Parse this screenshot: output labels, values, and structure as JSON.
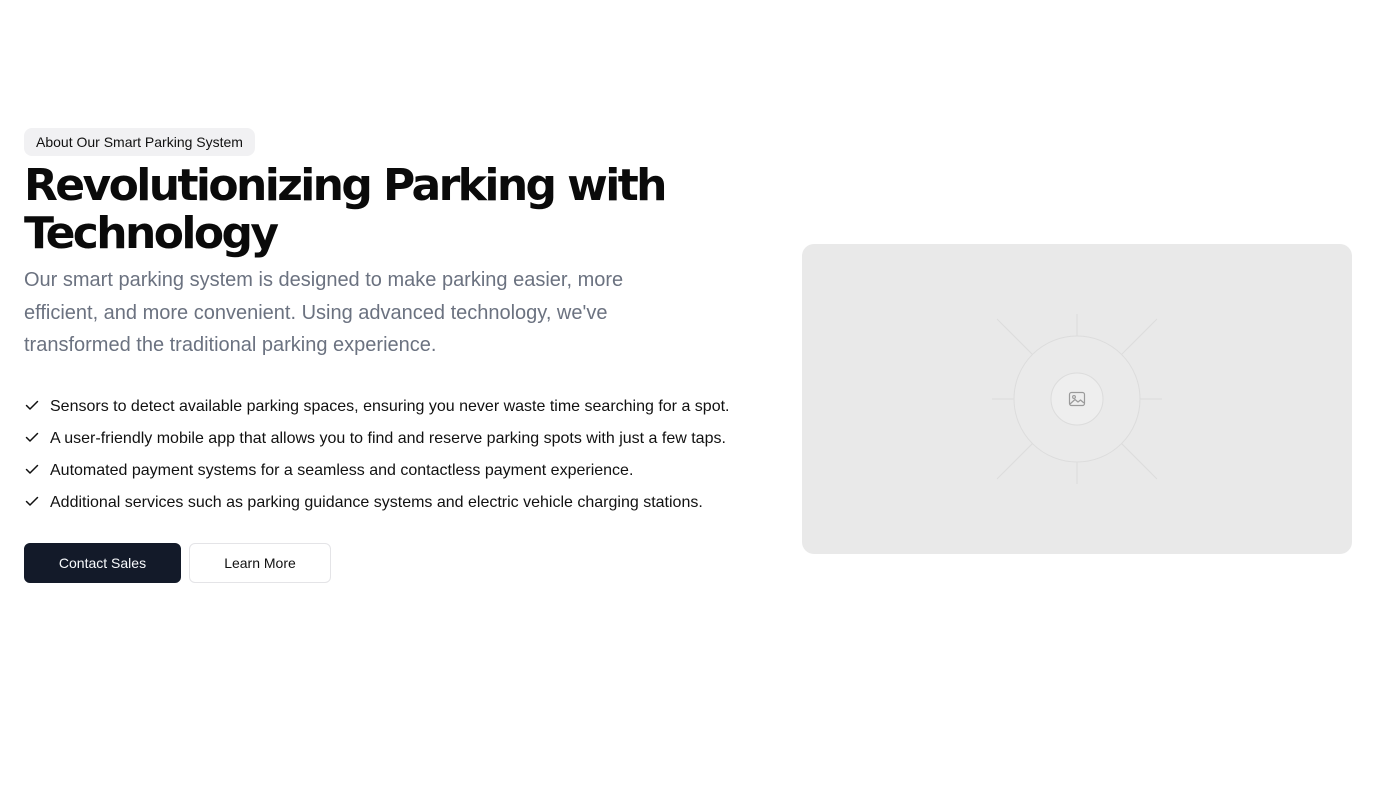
{
  "about": {
    "badge": "About Our Smart Parking System",
    "headline_line1": "Revolutionizing Parking with",
    "headline_line2": "Technology",
    "lead": "Our smart parking system is designed to make parking easier, more efficient, and more convenient. Using advanced technology, we've transformed the traditional parking experience."
  },
  "features": [
    {
      "icon": "check-icon",
      "text": "Sensors to detect available parking spaces, ensuring you never waste time searching for a spot."
    },
    {
      "icon": "check-icon",
      "text": "A user-friendly mobile app that allows you to find and reserve parking spots with just a few taps."
    },
    {
      "icon": "check-icon",
      "text": "Automated payment systems for a seamless and contactless payment experience."
    },
    {
      "icon": "check-icon",
      "text": "Additional services such as parking guidance systems and electric vehicle charging stations."
    }
  ],
  "buttons": {
    "primary_label": "Contact Sales",
    "secondary_label": "Learn More"
  },
  "image_placeholder": {
    "icon": "image-icon"
  },
  "colors": {
    "primary_button": "#131a29",
    "muted_text": "#6b7280",
    "badge_bg": "#f1f1f3",
    "placeholder_bg": "#e9e9e9"
  }
}
